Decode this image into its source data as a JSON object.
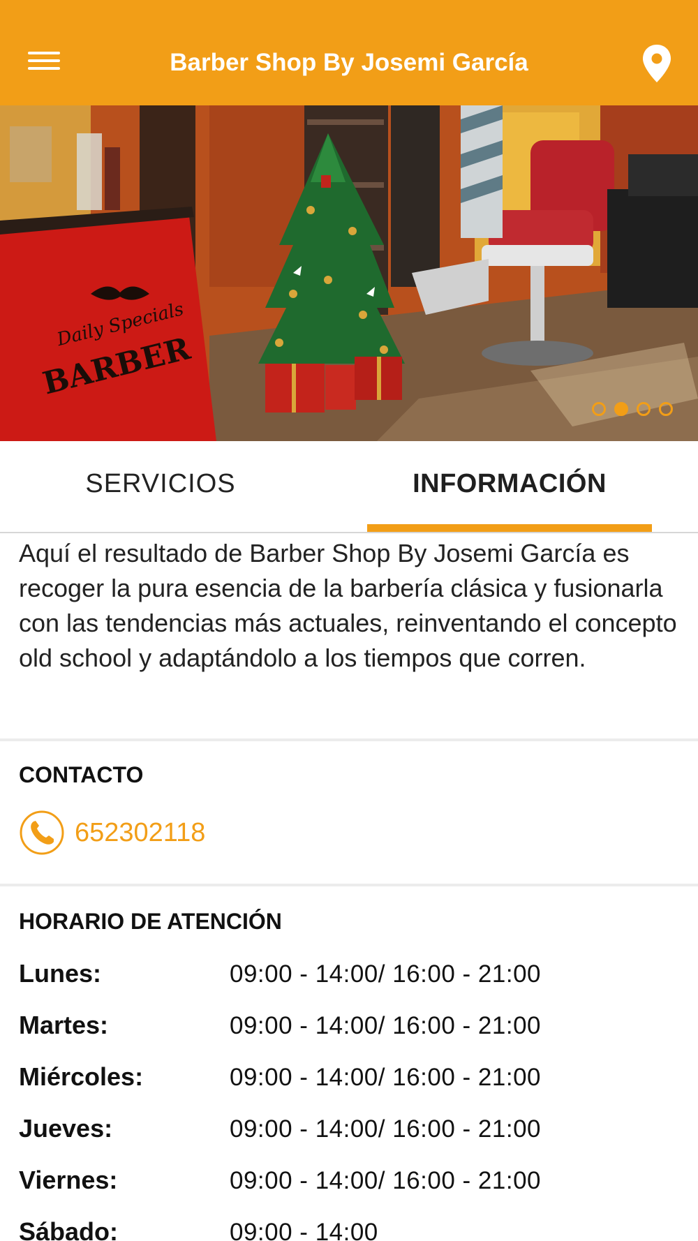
{
  "appbar": {
    "title": "Barber Shop By Josemi García",
    "menu_icon": "hamburger-menu-icon",
    "location_icon": "map-pin-icon",
    "color": "#f29e17"
  },
  "carousel": {
    "slide_count": 4,
    "active_index": 1
  },
  "tabs": [
    {
      "label": "SERVICIOS",
      "active": false
    },
    {
      "label": "INFORMACIÓN",
      "active": true
    }
  ],
  "info": {
    "description": "Aquí el resultado de Barber Shop By Josemi García es recoger la pura esencia de la barbería clásica y fusionarla con las tendencias más actuales, reinventando el concepto old school y adaptándolo a los tiempos que corren."
  },
  "contact": {
    "title": "CONTACTO",
    "phone_icon": "phone-icon",
    "phone": "652302118"
  },
  "hours": {
    "title": "HORARIO DE ATENCIÓN",
    "rows": [
      {
        "day": "Lunes:",
        "time": "09:00 - 14:00/ 16:00 - 21:00"
      },
      {
        "day": "Martes:",
        "time": "09:00 - 14:00/ 16:00 - 21:00"
      },
      {
        "day": "Miércoles:",
        "time": "09:00 - 14:00/ 16:00 - 21:00"
      },
      {
        "day": "Jueves:",
        "time": "09:00 - 14:00/ 16:00 - 21:00"
      },
      {
        "day": "Viernes:",
        "time": "09:00 - 14:00/ 16:00 - 21:00"
      },
      {
        "day": "Sábado:",
        "time": "09:00 - 14:00"
      }
    ]
  },
  "colors": {
    "accent": "#f29e17",
    "text": "#1d1d1d",
    "divider": "#ececec"
  }
}
